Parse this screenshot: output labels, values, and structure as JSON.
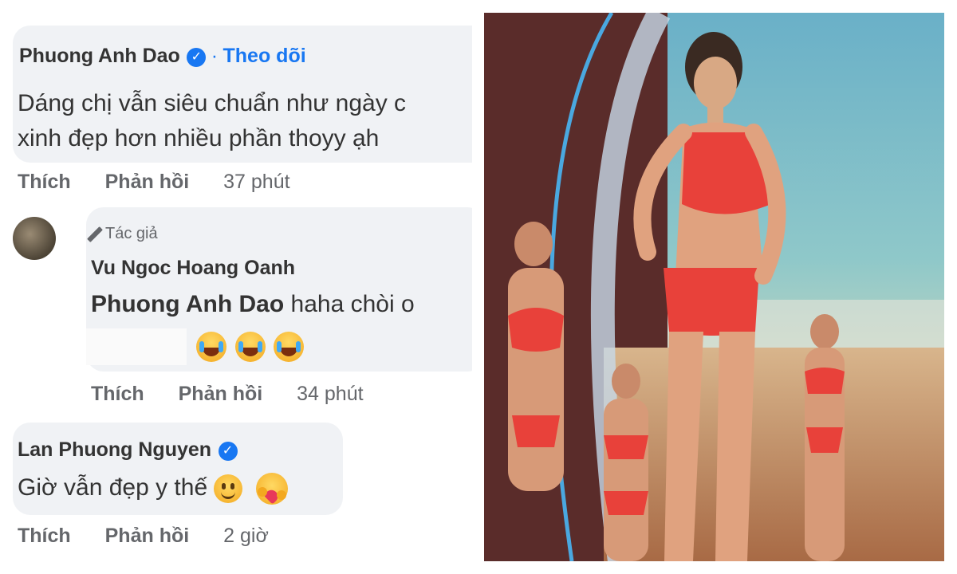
{
  "comments": [
    {
      "author": "Phuong Anh Dao",
      "verified": true,
      "follow_label": "Theo dõi",
      "text_line1": "Dáng chị vẫn siêu chuẩn như ngày c",
      "text_line2": "xinh đẹp hơn nhiều phần thoyy ạh",
      "like_label": "Thích",
      "reply_label": "Phản hồi",
      "time": "37 phút"
    },
    {
      "author_badge": "Tác giả",
      "author": "Vu Ngoc Hoang Oanh",
      "mention": "Phuong Anh Dao",
      "text": "haha chòi o",
      "like_label": "Thích",
      "reply_label": "Phản hồi",
      "time": "34 phút"
    },
    {
      "author": "Lan Phuong Nguyen",
      "verified": true,
      "text": "Giờ vẫn đẹp y thế",
      "like_label": "Thích",
      "reply_label": "Phản hồi",
      "time": "2 giờ"
    }
  ],
  "icons": {
    "verified": "verified-check-icon",
    "pencil": "pencil-icon",
    "laugh": "laughing-emoji-icon",
    "smile": "smile-emoji-icon",
    "hug": "hug-emoji-icon"
  },
  "colors": {
    "link_blue": "#1877f2",
    "bubble_bg": "#f0f2f5",
    "action_gray": "#65676b",
    "swimsuit_red": "#e8413a"
  }
}
